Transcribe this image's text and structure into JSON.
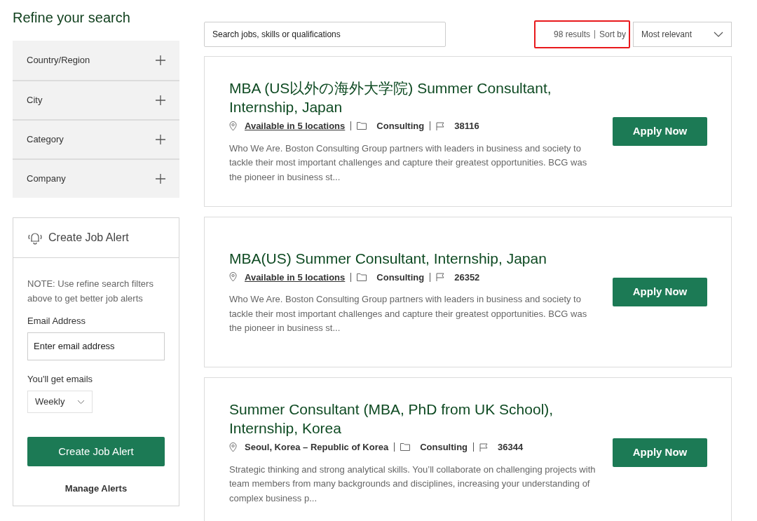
{
  "sidebar": {
    "title": "Refine your search",
    "filters": [
      {
        "label": "Country/Region",
        "expanded": false
      },
      {
        "label": "City",
        "expanded": false
      },
      {
        "label": "Category",
        "expanded": false
      },
      {
        "label": "Company",
        "expanded": false
      }
    ],
    "job_alert": {
      "title": "Create Job Alert",
      "note": "NOTE: Use refine search filters above to get better job alerts",
      "email_label": "Email Address",
      "email_placeholder": "Enter email address",
      "frequency_label": "You'll get emails",
      "frequency": "Weekly",
      "create_button": "Create Job Alert",
      "manage_link": "Manage Alerts"
    }
  },
  "search": {
    "placeholder": "Search jobs, skills or qualifications"
  },
  "results": {
    "count": "98 results",
    "sort_label": "Sort by",
    "sort_value": "Most relevant",
    "highlighted": true
  },
  "jobs": [
    {
      "title": "MBA (US以外の海外大学院) Summer Consultant, Internship, Japan",
      "location": "Available in 5 locations",
      "location_linked": true,
      "category": "Consulting",
      "id": "38116",
      "description": "Who We Are. Boston Consulting Group partners with leaders in business and society to tackle their most important challenges and capture their greatest opportunities. BCG was the pioneer in business st...",
      "button": "Apply Now"
    },
    {
      "title": "MBA(US) Summer Consultant, Internship, Japan",
      "location": "Available in 5 locations",
      "location_linked": true,
      "category": "Consulting",
      "id": "26352",
      "description": "Who We Are. Boston Consulting Group partners with leaders in business and society to tackle their most important challenges and capture their greatest opportunities. BCG was the pioneer in business st...",
      "button": "Apply Now"
    },
    {
      "title": "Summer Consultant (MBA, PhD from UK School), Internship, Korea",
      "location": "Seoul, Korea – Republic of Korea",
      "location_linked": false,
      "category": "Consulting",
      "id": "36344",
      "description": "Strategic thinking and strong analytical skills. You’ll collaborate on challenging projects with team members from many backgrounds and disciplines, increasing your understanding of complex business p...",
      "button": "Apply Now"
    }
  ]
}
